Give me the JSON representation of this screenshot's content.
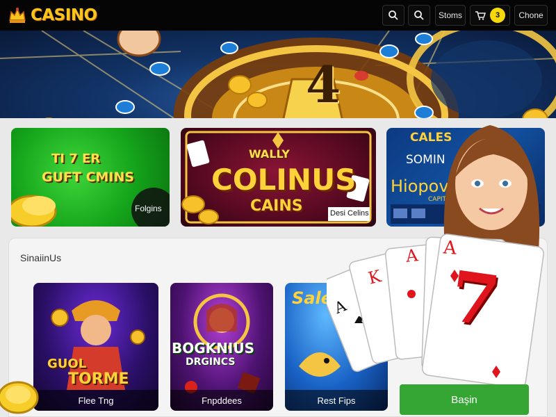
{
  "header": {
    "brand": "CASINO",
    "buttons": [
      {
        "name": "search",
        "icon": "search-icon"
      },
      {
        "name": "search-2",
        "icon": "search-icon"
      },
      {
        "label": "Stoms"
      },
      {
        "icon": "cart-icon",
        "badge": "3"
      },
      {
        "label": "Chone"
      }
    ]
  },
  "hero": {
    "banner_text": "4"
  },
  "promos": [
    {
      "title_line1": "TI 7 ER",
      "title_line2": "GUFT CMINS",
      "chip": "Folgins"
    },
    {
      "title_line1": "WALLY",
      "title_line2": "COLINUS",
      "title_line3": "CAINS",
      "chip": "Desi Celins"
    },
    {
      "title_line1": "CALES",
      "title_line2": "SOMIN",
      "title_line3": "Hiopov",
      "title_line4": "CAPIT"
    }
  ],
  "games_section": {
    "title": "SinaiinUs",
    "games": [
      {
        "title_line1": "GUOL",
        "title_line2": "TORME",
        "caption": "Flee Tng"
      },
      {
        "title_line1": "BOGKNIUS",
        "title_line2": "DRGINCS",
        "caption": "Fnpddees"
      },
      {
        "title_line1": "Sale",
        "caption": "Rest Fips"
      }
    ],
    "join_label": "Başin"
  },
  "cards": [
    "A",
    "K",
    "A",
    "A",
    "7"
  ],
  "colors": {
    "brand": "#f7c51d",
    "join": "#35a534",
    "header": "#050505",
    "card_red": "#e0141c"
  }
}
